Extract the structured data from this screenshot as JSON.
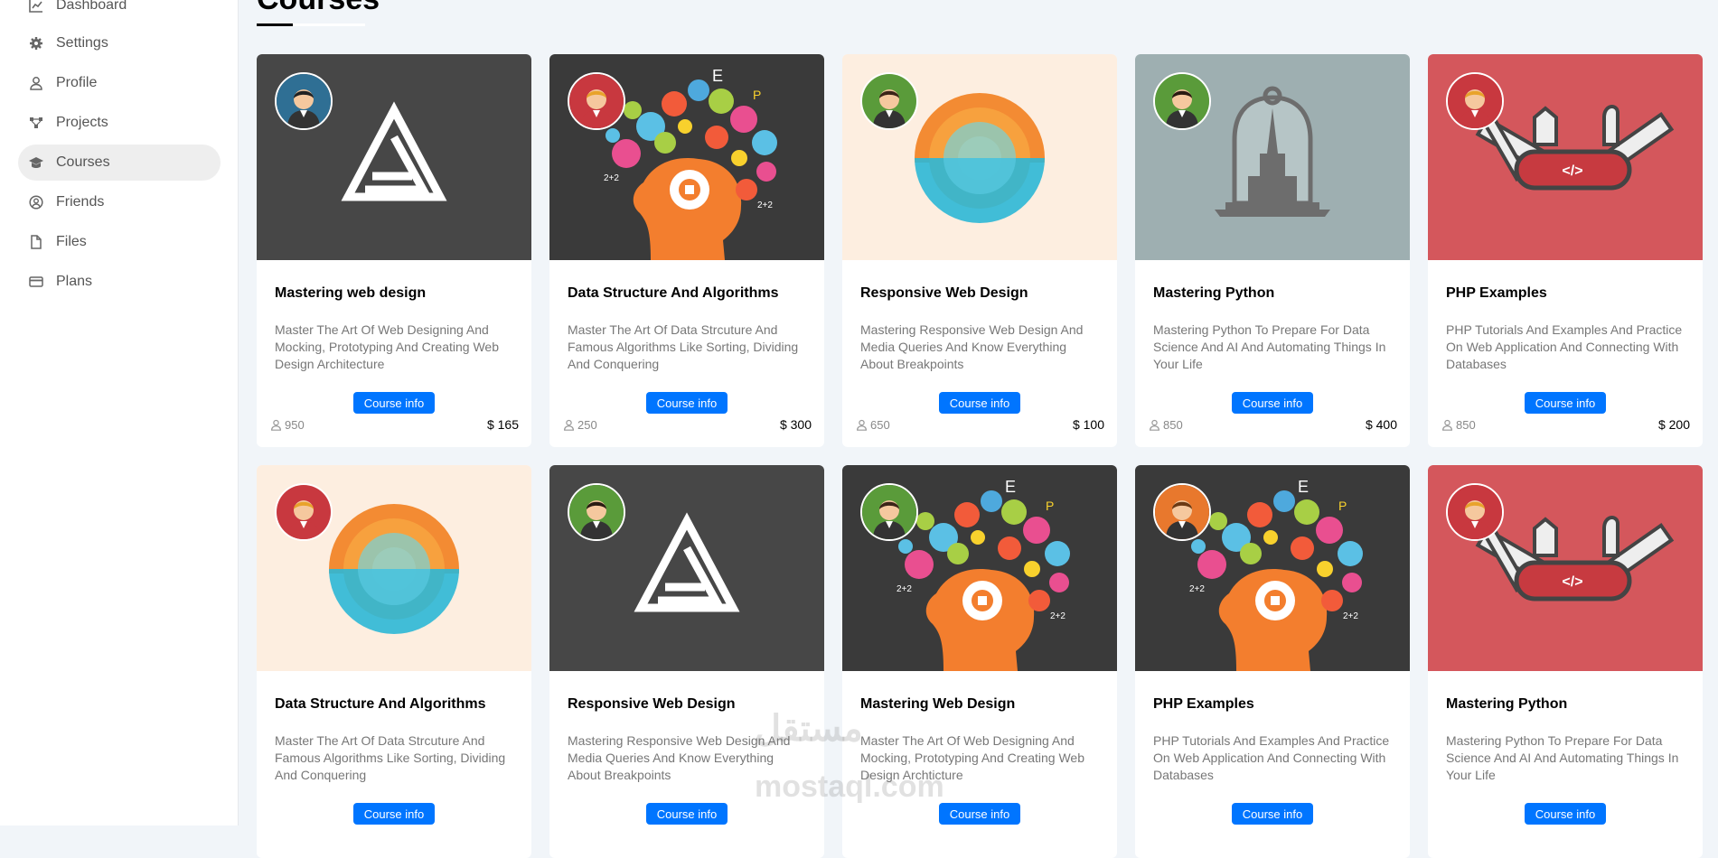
{
  "sidebar": {
    "items": [
      {
        "label": "Dashboard",
        "icon": "chart-line-icon"
      },
      {
        "label": "Settings",
        "icon": "gear-icon"
      },
      {
        "label": "Profile",
        "icon": "user-icon"
      },
      {
        "label": "Projects",
        "icon": "diagram-icon"
      },
      {
        "label": "Courses",
        "icon": "graduation-cap-icon",
        "active": true
      },
      {
        "label": "Friends",
        "icon": "user-circle-icon"
      },
      {
        "label": "Files",
        "icon": "file-icon"
      },
      {
        "label": "Plans",
        "icon": "credit-card-icon"
      }
    ]
  },
  "page": {
    "title": "Courses"
  },
  "button_label": "Course info",
  "currency": "$",
  "courses": [
    {
      "title": "Mastering web design",
      "desc": "Master The Art Of Web Designing And Mocking, Prototyping And Creating Web Design Architecture",
      "students": "950",
      "price": "165",
      "image": "triangle-logo",
      "avatar": "blue-man"
    },
    {
      "title": "Data Structure And Algorithms",
      "desc": "Master The Art Of Data Strcuture And Famous Algorithms Like Sorting, Dividing And Conquering",
      "students": "250",
      "price": "300",
      "image": "brain-head",
      "avatar": "red-woman"
    },
    {
      "title": "Responsive Web Design",
      "desc": "Mastering Responsive Web Design And Media Queries And Know Everything About Breakpoints",
      "students": "650",
      "price": "100",
      "image": "sunset-circle",
      "avatar": "green-man"
    },
    {
      "title": "Mastering Python",
      "desc": "Mastering Python To Prepare For Data Science And AI And Automating Things In Your Life",
      "students": "850",
      "price": "400",
      "image": "bell-jar",
      "avatar": "green-woman"
    },
    {
      "title": "PHP Examples",
      "desc": "PHP Tutorials And Examples And Practice On Web Application And Connecting With Databases",
      "students": "850",
      "price": "200",
      "image": "swiss-knife",
      "avatar": "red-woman"
    },
    {
      "title": "Data Structure And Algorithms",
      "desc": "Master The Art Of Data Strcuture And Famous Algorithms Like Sorting, Dividing And Conquering",
      "students": "",
      "price": "",
      "image": "sunset-circle",
      "avatar": "red-woman"
    },
    {
      "title": "Responsive Web Design",
      "desc": "Mastering Responsive Web Design And Media Queries And Know Everything About Breakpoints",
      "students": "",
      "price": "",
      "image": "triangle-logo",
      "avatar": "green-woman"
    },
    {
      "title": "Mastering Web Design",
      "desc": "Master The Art Of Web Designing And Mocking, Prototyping And Creating Web Design Archticture",
      "students": "",
      "price": "",
      "image": "brain-head",
      "avatar": "green-man"
    },
    {
      "title": "PHP Examples",
      "desc": "PHP Tutorials And Examples And Practice On Web Application And Connecting With Databases",
      "students": "",
      "price": "",
      "image": "brain-head",
      "avatar": "orange-woman"
    },
    {
      "title": "Mastering Python",
      "desc": "Mastering Python To Prepare For Data Science And AI And Automating Things In Your Life",
      "students": "",
      "price": "",
      "image": "swiss-knife",
      "avatar": "red-woman"
    }
  ],
  "watermark": {
    "arabic": "مستقل",
    "latin": "mostaql.com"
  },
  "colors": {
    "accent": "#0075ff",
    "background": "#f1f5f9"
  }
}
